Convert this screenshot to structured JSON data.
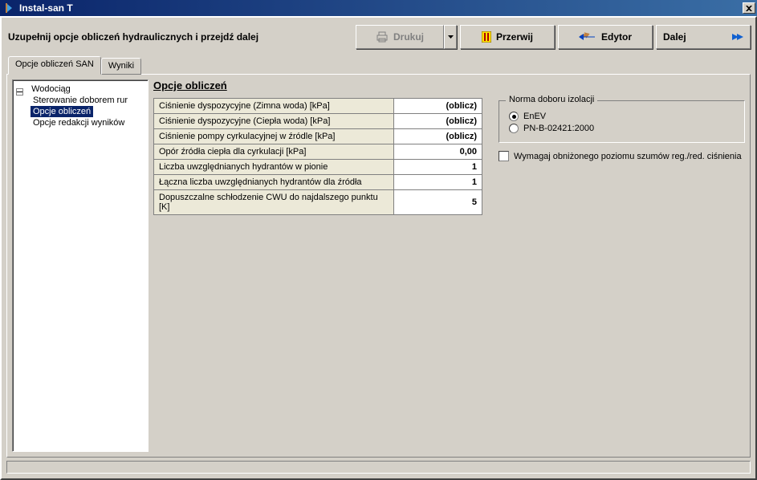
{
  "window": {
    "title": "Instal-san T"
  },
  "toolbar": {
    "instruction": "Uzupełnij opcje obliczeń hydraulicznych i przejdź dalej",
    "print_label": "Drukuj",
    "interrupt_label": "Przerwij",
    "editor_label": "Edytor",
    "next_label": "Dalej"
  },
  "tabs": {
    "tab1": "Opcje obliczeń SAN",
    "tab2": "Wyniki"
  },
  "tree": {
    "root": "Wodociąg",
    "items": [
      "Sterowanie doborem rur",
      "Opcje obliczeń",
      "Opcje redakcji wyników"
    ],
    "selected_index": 1
  },
  "panel": {
    "heading": "Opcje obliczeń"
  },
  "params": [
    {
      "label": "Ciśnienie dyspozycyjne (Zimna woda) [kPa]",
      "value": "(oblicz)"
    },
    {
      "label": "Ciśnienie dyspozycyjne (Ciepła woda) [kPa]",
      "value": "(oblicz)"
    },
    {
      "label": "Ciśnienie pompy cyrkulacyjnej w źródle [kPa]",
      "value": "(oblicz)"
    },
    {
      "label": "Opór źródła ciepła dla cyrkulacji [kPa]",
      "value": "0,00"
    },
    {
      "label": "Liczba uwzględnianych hydrantów w pionie",
      "value": "1"
    },
    {
      "label": "Łączna liczba uwzględnianych hydrantów dla źródła",
      "value": "1"
    },
    {
      "label": "Dopuszczalne schłodzenie CWU do najdalszego punktu [K]",
      "value": "5"
    }
  ],
  "insulation_group": {
    "title": "Norma doboru izolacji",
    "options": [
      "EnEV",
      "PN-B-02421:2000"
    ],
    "selected_index": 0
  },
  "noise_checkbox": {
    "label": "Wymagaj obniżonego poziomu szumów reg./red. ciśnienia",
    "checked": false
  }
}
